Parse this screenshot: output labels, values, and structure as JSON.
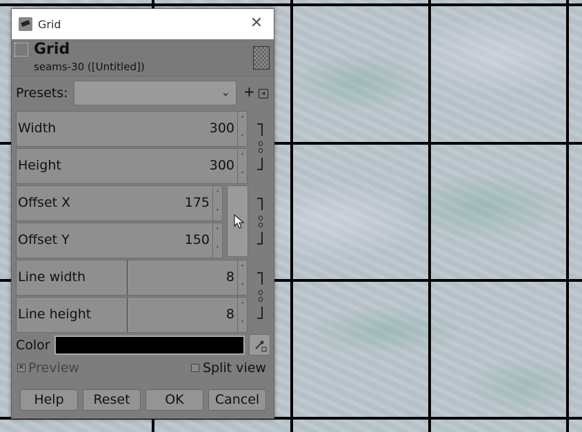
{
  "window": {
    "title": "Grid"
  },
  "header": {
    "title": "Grid",
    "subtitle": "seams-30 ([Untitled])"
  },
  "presets": {
    "label": "Presets:",
    "value": ""
  },
  "fields": [
    {
      "label": "Width",
      "value": "300"
    },
    {
      "label": "Height",
      "value": "300"
    },
    {
      "label": "Offset X",
      "value": "175"
    },
    {
      "label": "Offset Y",
      "value": "150"
    },
    {
      "label": "Line width",
      "value": "8"
    },
    {
      "label": "Line height",
      "value": "8"
    }
  ],
  "color": {
    "label": "Color",
    "value": "#000000"
  },
  "options": {
    "preview": "Preview",
    "preview_checked": true,
    "split_view": "Split view",
    "split_view_checked": false
  },
  "buttons": {
    "help": "Help",
    "reset": "Reset",
    "ok": "OK",
    "cancel": "Cancel"
  },
  "icons": {
    "close": "close-icon",
    "add": "plus-icon",
    "menu": "menu-icon",
    "picker": "color-picker-icon"
  }
}
